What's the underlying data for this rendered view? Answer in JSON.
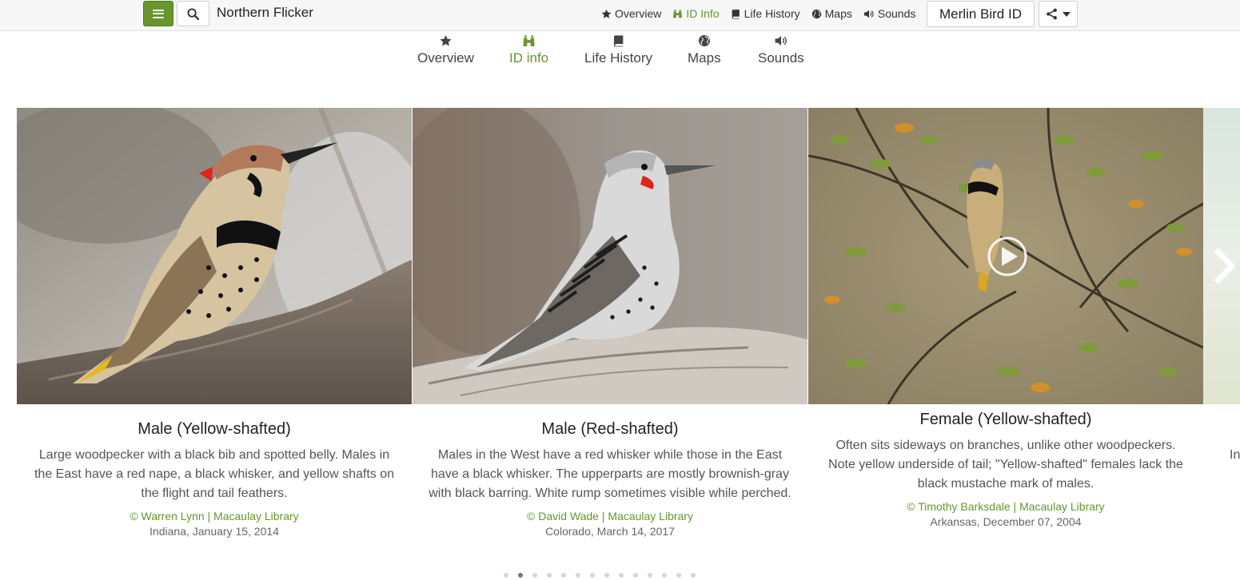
{
  "header": {
    "species": "Northern Flicker",
    "nav": [
      {
        "label": "Overview",
        "icon": "star-icon"
      },
      {
        "label": "ID Info",
        "icon": "binoculars-icon",
        "active": true
      },
      {
        "label": "Life History",
        "icon": "book-icon"
      },
      {
        "label": "Maps",
        "icon": "globe-icon"
      },
      {
        "label": "Sounds",
        "icon": "speaker-icon"
      }
    ],
    "merlin_label": "Merlin Bird ID",
    "menu_icon": "hamburger-icon",
    "search_icon": "search-icon",
    "share_icon": "share-icon"
  },
  "tabs": [
    {
      "label": "Overview",
      "icon": "star-icon"
    },
    {
      "label": "ID info",
      "icon": "binoculars-icon",
      "active": true
    },
    {
      "label": "Life History",
      "icon": "book-icon"
    },
    {
      "label": "Maps",
      "icon": "globe-icon"
    },
    {
      "label": "Sounds",
      "icon": "speaker-icon"
    }
  ],
  "cards": [
    {
      "title": "Male (Yellow-shafted)",
      "description": "Large woodpecker with a black bib and spotted belly. Males in the East have a red nape, a black whisker, and yellow shafts on the flight and tail feathers.",
      "credit": "© Warren Lynn | Macaulay Library",
      "location_date": "Indiana, January 15, 2014"
    },
    {
      "title": "Male (Red-shafted)",
      "description": "Males in the West have a red whisker while those in the East have a black whisker. The upperparts are mostly brownish-gray with black barring. White rump sometimes visible while perched.",
      "credit": "© David Wade | Macaulay Library",
      "location_date": "Colorado, March 14, 2017"
    },
    {
      "title": "Female (Yellow-shafted)",
      "description": "Often sits sideways on branches, unlike other woodpeckers. Note yellow underside of tail; \"Yellow-shafted\" females lack the black mustache mark of males.",
      "credit": "© Timothy Barksdale | Macaulay Library",
      "location_date": "Arkansas, December 07, 2004",
      "has_video": true
    }
  ],
  "next_card_peek": "In",
  "carousel": {
    "page_count": 14,
    "active_index": 1
  },
  "colors": {
    "accent": "#67962e",
    "red_patch": "#e2231a"
  }
}
